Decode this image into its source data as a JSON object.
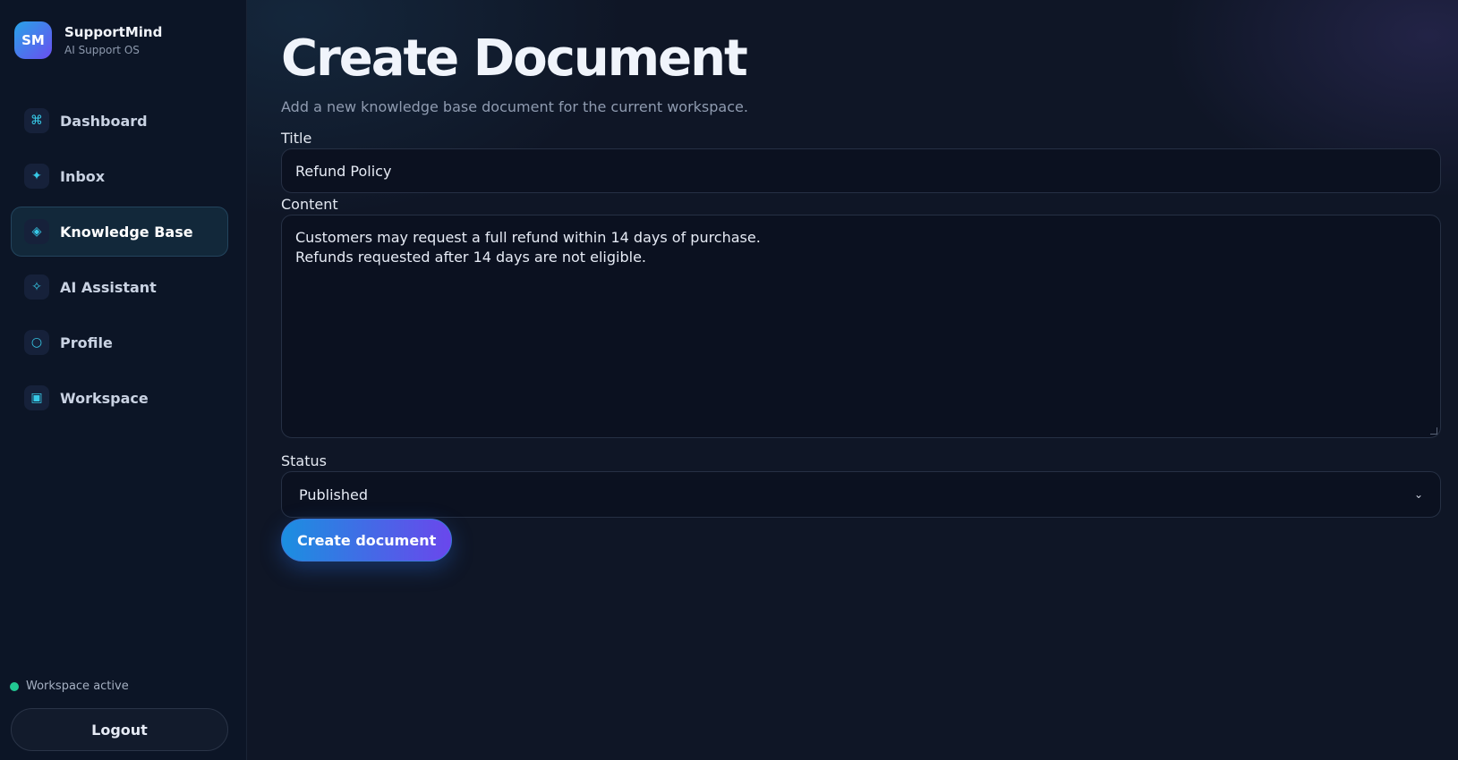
{
  "brand": {
    "initials": "SM",
    "name": "SupportMind",
    "subtitle": "AI Support OS"
  },
  "sidebar": {
    "items": [
      {
        "label": "Dashboard",
        "icon": "⌘",
        "icon_name": "command-icon",
        "active": false
      },
      {
        "label": "Inbox",
        "icon": "✦",
        "icon_name": "sparkle-icon",
        "active": false
      },
      {
        "label": "Knowledge Base",
        "icon": "◈",
        "icon_name": "diamond-icon",
        "active": true
      },
      {
        "label": "AI Assistant",
        "icon": "✧",
        "icon_name": "star-outline-icon",
        "active": false
      },
      {
        "label": "Profile",
        "icon": "○",
        "icon_name": "circle-icon",
        "active": false
      },
      {
        "label": "Workspace",
        "icon": "▣",
        "icon_name": "square-icon",
        "active": false
      }
    ],
    "status_text": "Workspace active",
    "status_color": "#22c993",
    "logout_label": "Logout"
  },
  "page": {
    "title": "Create Document",
    "subtitle": "Add a new knowledge base document for the current workspace."
  },
  "form": {
    "title_label": "Title",
    "title_value": "Refund Policy",
    "content_label": "Content",
    "content_value": "Customers may request a full refund within 14 days of purchase.\nRefunds requested after 14 days are not eligible.",
    "status_label": "Status",
    "status_value": "Published",
    "submit_label": "Create document"
  },
  "colors": {
    "accent_start": "#1b8fe0",
    "accent_end": "#6a47ec",
    "background": "#0f1626"
  }
}
